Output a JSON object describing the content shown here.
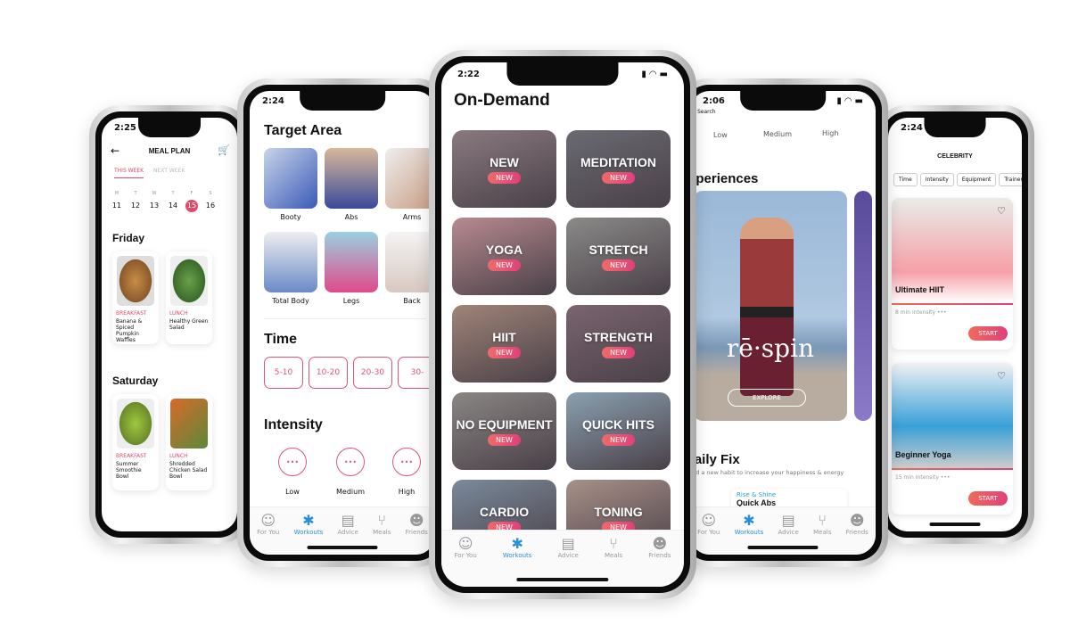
{
  "meal_plan": {
    "time": "2:25",
    "title": "MEAL PLAN",
    "tabs": [
      "THIS WEEK",
      "NEXT WEEK"
    ],
    "weekdays": [
      "M",
      "T",
      "W",
      "T",
      "F",
      "S"
    ],
    "dates": [
      "11",
      "12",
      "13",
      "14",
      "15",
      "16"
    ],
    "selected_date": "15",
    "days": [
      {
        "name": "Friday",
        "meals": [
          {
            "type": "BREAKFAST",
            "name": "Banana & Spiced Pumpkin Waffles"
          },
          {
            "type": "LUNCH",
            "name": "Healthy Green Salad"
          }
        ]
      },
      {
        "name": "Saturday",
        "meals": [
          {
            "type": "BREAKFAST",
            "name": "Summer Smoothie Bowl"
          },
          {
            "type": "LUNCH",
            "name": "Shredded Chicken Salad Bowl"
          }
        ]
      }
    ]
  },
  "filters": {
    "time": "2:24",
    "target_title": "Target Area",
    "targets": [
      "Booty",
      "Abs",
      "Arms",
      "Total Body",
      "Legs",
      "Back"
    ],
    "time_title": "Time",
    "times": [
      "5-10",
      "10-20",
      "20-30",
      "30-"
    ],
    "intensity_title": "Intensity",
    "intensities": [
      "Low",
      "Medium",
      "High"
    ]
  },
  "on_demand": {
    "time": "2:22",
    "title": "On-Demand",
    "badge": "NEW",
    "categories": [
      "NEW",
      "MEDITATION",
      "YOGA",
      "STRETCH",
      "HIIT",
      "STRENGTH",
      "NO EQUIPMENT",
      "QUICK HITS",
      "CARDIO",
      "TONING"
    ]
  },
  "nav": [
    "For You",
    "Workouts",
    "Advice",
    "Meals",
    "Friends"
  ],
  "experiences": {
    "time": "2:06",
    "back": "Search",
    "intensities": [
      "Low",
      "Medium",
      "High"
    ],
    "title": "Experiences",
    "brand": "rē·spin",
    "explore": "EXPLORE",
    "daily_title": "Daily Fix",
    "daily_sub": "Build a new habit to increase your happiness & energy",
    "daily_tag": "Rise & Shine",
    "daily_name": "Quick Abs"
  },
  "celebrity": {
    "time": "2:24",
    "title": "CELEBRITY",
    "filters": [
      "Time",
      "Intensity",
      "Equipment",
      "Trainer"
    ],
    "workouts": [
      {
        "name": "Ultimate HIIT",
        "meta": "8 min  Intensity •••",
        "cta": "START"
      },
      {
        "name": "Beginner Yoga",
        "meta": "15 min  Intensity •••",
        "cta": "START"
      }
    ]
  },
  "colors": {
    "accent": "#e04a6a",
    "active_nav": "#2a8fd8"
  }
}
